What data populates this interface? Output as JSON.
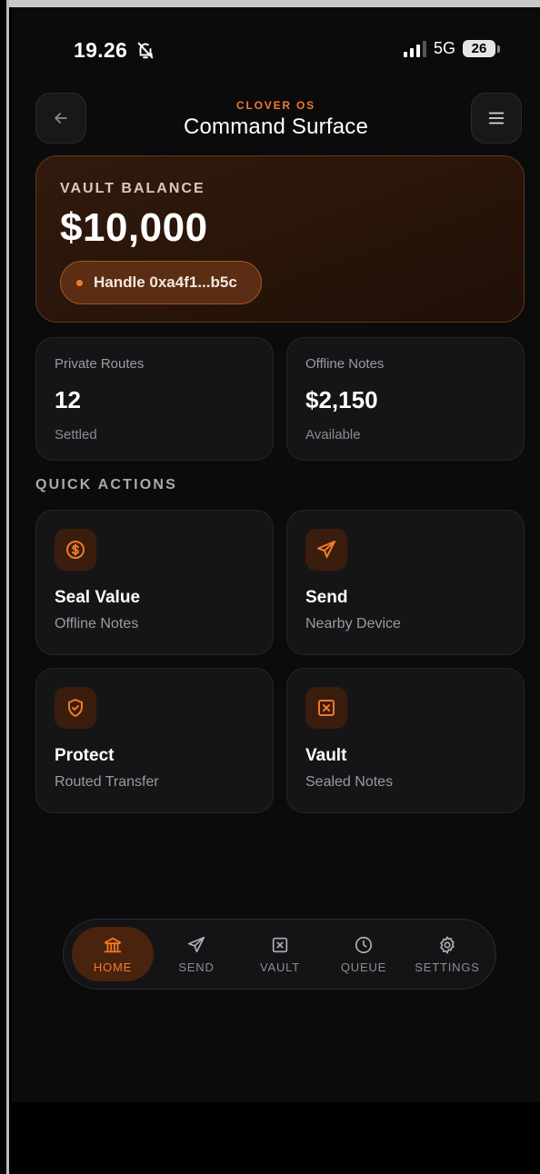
{
  "status": {
    "time": "19.26",
    "network": "5G",
    "battery": "26"
  },
  "header": {
    "kicker": "CLOVER OS",
    "title": "Command Surface"
  },
  "vault": {
    "label": "VAULT BALANCE",
    "amount": "$10,000",
    "handle": "Handle 0xa4f1...b5c"
  },
  "stats": [
    {
      "label": "Private Routes",
      "value": "12",
      "sub": "Settled"
    },
    {
      "label": "Offline Notes",
      "value": "$2,150",
      "sub": "Available"
    }
  ],
  "quick_actions": {
    "title": "QUICK ACTIONS",
    "items": [
      {
        "title": "Seal Value",
        "sub": "Offline Notes",
        "icon": "dollar-circle-icon"
      },
      {
        "title": "Send",
        "sub": "Nearby Device",
        "icon": "send-icon"
      },
      {
        "title": "Protect",
        "sub": "Routed Transfer",
        "icon": "shield-icon"
      },
      {
        "title": "Vault",
        "sub": "Sealed Notes",
        "icon": "vault-icon"
      }
    ]
  },
  "nav": {
    "active": "HOME",
    "items": [
      {
        "label": "HOME",
        "icon": "bank-icon"
      },
      {
        "label": "SEND",
        "icon": "send-icon"
      },
      {
        "label": "VAULT",
        "icon": "vault-icon"
      },
      {
        "label": "QUEUE",
        "icon": "clock-icon"
      },
      {
        "label": "SETTINGS",
        "icon": "gear-icon"
      }
    ]
  },
  "colors": {
    "accent": "#f07a2b",
    "background": "#0b0b0c",
    "card": "#151517",
    "vault_card": "#2a150a"
  }
}
